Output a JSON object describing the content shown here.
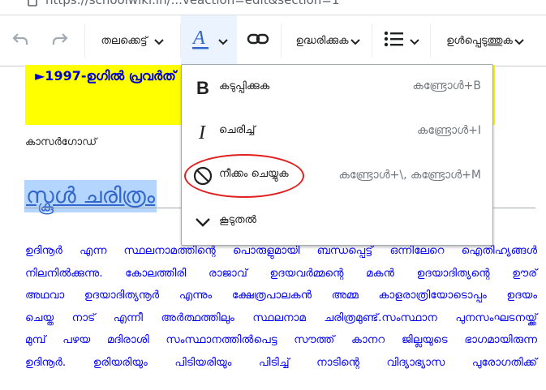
{
  "browser": {
    "url": "https://schoolwiki.in/...veaction=edit&section=1"
  },
  "toolbar": {
    "undo_icon": "undo-icon",
    "redo_icon": "redo-icon",
    "paragraph_label": "തലക്കെട്ട്",
    "text_style_icon": "text-style-icon",
    "link_icon": "link-icon",
    "cite_label": "ഉദ്ധരിക്കുക",
    "list_icon": "bullet-list-icon",
    "insert_label": "ഉൾപ്പെടുത്തുക",
    "active_color": "#3366cc"
  },
  "page": {
    "banner_text": "►1997-ഉഗിൽ പ്രവർത്",
    "banner_color": "#ffff00",
    "location": "കാസർഗോഡ്",
    "heading": "സ്കൂൾ ചരിത്രം",
    "body_lines": [
      "ഉദിനൂർ എന്ന സ്ഥലനാമത്തിന്റെ പൊരുളുമായി ബന്ധപ്പെട്ട് ഒന്നിലേറെ ഐതിഹ്യങ്ങൾ",
      "നിലനിൽക്കുന്നു. കോലത്തിരി രാജാവ് ഉദയവർമ്മന്റെ മകൻ ഉദയാദിത്യന്റെ ഊര്",
      "അഥവാ ഉദയാദിത്യനൂർ എന്നും ക്ഷേത്രപാലകൻ അമ്മ കാളരാത്രിയോടൊപ്പം ഉദയം",
      "ചെയ്ത നാട് എന്നീ അർത്ഥത്തിലും സ്ഥലനാമ ചരിത്രമുണ്ട്.സംസ്ഥാന പുനസംഘടനയ്ക്ക്",
      "മുമ്പ് പഴയ മദിരാശി സംസ്ഥാനത്തിൽപെട്ട സൗത്ത് കാനറ ജില്ലയുടെ ഭാഗമായിരുന്ന",
      "ഉദിനൂർ. ഉരിയരിയും പിടിയരിയും പിടിച്ച് നാടിന്റെ വിദ്യാഭ്യാസ പുരോഗതിക്ക്"
    ],
    "text_color": "#0000ff"
  },
  "dropdown": {
    "items": [
      {
        "label": "കടുപ്പിക്കുക",
        "shortcut": "കണ്ട്രോൾ+B",
        "icon": "bold-icon"
      },
      {
        "label": "ചെരിച്ച്",
        "shortcut": "കണ്ട്രോൾ+I",
        "icon": "italic-icon"
      },
      {
        "label": "നീക്കം ചെയ്യുക",
        "shortcut": "കണ്ട്രോൾ+\\, കണ്ട്രോൾ+M",
        "icon": "clear-formatting-icon"
      },
      {
        "label": "കൂടുതൽ",
        "shortcut": "",
        "icon": "chevron-down-icon"
      }
    ],
    "highlight_color": "#e02020"
  }
}
